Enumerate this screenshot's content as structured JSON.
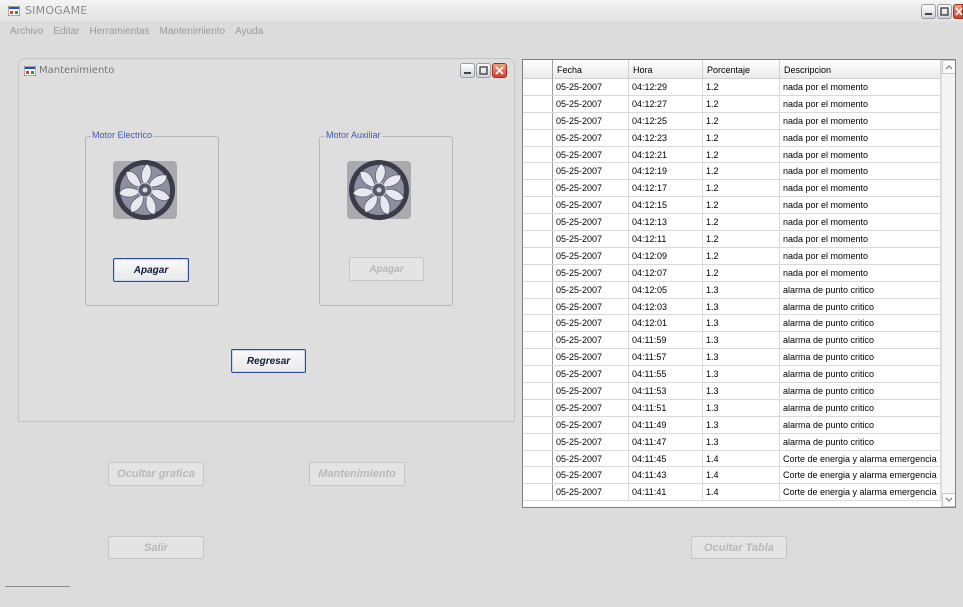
{
  "app": {
    "title": "SIMOGAME"
  },
  "menu": [
    "Archivo",
    "Editar",
    "Herramientas",
    "Mantenimiento",
    "Ayuda"
  ],
  "mantenimiento": {
    "title": "Mantenimiento",
    "motor_electrico": {
      "label": "Motor Electrico",
      "button": "Apagar"
    },
    "motor_auxiliar": {
      "label": "Motor Auxiliar",
      "button": "Apagar"
    },
    "regresar": "Regresar"
  },
  "buttons": {
    "ocultar_grafica": "Ocultar grafica",
    "mantenimiento": "Mantenimiento",
    "salir": "Salir",
    "ocultar_tabla": "Ocultar Tabla"
  },
  "table": {
    "columns": [
      "Fecha",
      "Hora",
      "Porcentaje",
      "Descripcion"
    ],
    "rows": [
      [
        "05-25-2007",
        "04:12:29",
        "1.2",
        "nada por el momento"
      ],
      [
        "05-25-2007",
        "04:12:27",
        "1.2",
        "nada por el momento"
      ],
      [
        "05-25-2007",
        "04:12:25",
        "1.2",
        "nada por el momento"
      ],
      [
        "05-25-2007",
        "04:12:23",
        "1.2",
        "nada por el momento"
      ],
      [
        "05-25-2007",
        "04:12:21",
        "1.2",
        "nada por el momento"
      ],
      [
        "05-25-2007",
        "04:12:19",
        "1.2",
        "nada por el momento"
      ],
      [
        "05-25-2007",
        "04:12:17",
        "1.2",
        "nada por el momento"
      ],
      [
        "05-25-2007",
        "04:12:15",
        "1.2",
        "nada por el momento"
      ],
      [
        "05-25-2007",
        "04:12:13",
        "1.2",
        "nada por el momento"
      ],
      [
        "05-25-2007",
        "04:12:11",
        "1.2",
        "nada por el momento"
      ],
      [
        "05-25-2007",
        "04:12:09",
        "1.2",
        "nada por el momento"
      ],
      [
        "05-25-2007",
        "04:12:07",
        "1.2",
        "nada por el momento"
      ],
      [
        "05-25-2007",
        "04:12:05",
        "1.3",
        "alarma de punto critico"
      ],
      [
        "05-25-2007",
        "04:12:03",
        "1.3",
        "alarma de punto critico"
      ],
      [
        "05-25-2007",
        "04:12:01",
        "1.3",
        "alarma de punto critico"
      ],
      [
        "05-25-2007",
        "04:11:59",
        "1.3",
        "alarma de punto critico"
      ],
      [
        "05-25-2007",
        "04:11:57",
        "1.3",
        "alarma de punto critico"
      ],
      [
        "05-25-2007",
        "04:11:55",
        "1.3",
        "alarma de punto critico"
      ],
      [
        "05-25-2007",
        "04:11:53",
        "1.3",
        "alarma de punto critico"
      ],
      [
        "05-25-2007",
        "04:11:51",
        "1.3",
        "alarma de punto critico"
      ],
      [
        "05-25-2007",
        "04:11:49",
        "1.3",
        "alarma de punto critico"
      ],
      [
        "05-25-2007",
        "04:11:47",
        "1.3",
        "alarma de punto critico"
      ],
      [
        "05-25-2007",
        "04:11:45",
        "1.4",
        "Corte de energia y alarma emergencia"
      ],
      [
        "05-25-2007",
        "04:11:43",
        "1.4",
        "Corte de energia y alarma emergencia"
      ],
      [
        "05-25-2007",
        "04:11:41",
        "1.4",
        "Corte de energia y alarma emergencia"
      ]
    ]
  }
}
